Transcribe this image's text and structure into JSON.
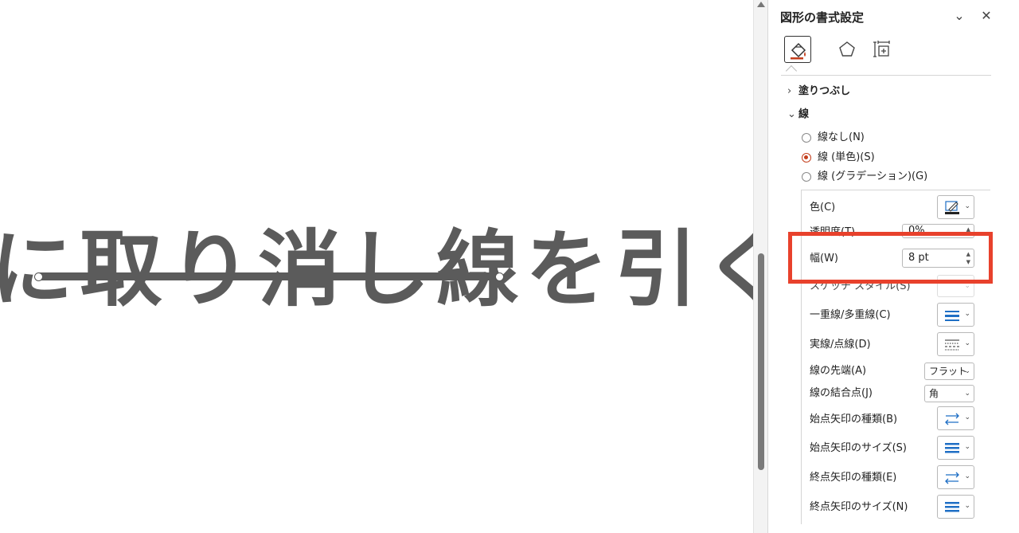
{
  "canvas": {
    "slide_text": "に取り消し線を引く"
  },
  "pane": {
    "title": "図形の書式設定",
    "collapse_glyph": "⌄",
    "close_glyph": "✕",
    "tabs": [
      "fill-and-line",
      "effects",
      "size-and-properties"
    ],
    "sections": {
      "fill": {
        "label": "塗りつぶし",
        "expanded": false
      },
      "line": {
        "label": "線",
        "expanded": true
      }
    },
    "line_options": [
      {
        "label": "線なし(N)",
        "selected": false
      },
      {
        "label": "線 (単色)(S)",
        "selected": true
      },
      {
        "label": "線 (グラデーション)(G)",
        "selected": false
      }
    ],
    "props": {
      "color": {
        "label": "色(C)"
      },
      "transparency": {
        "label": "透明度(T)",
        "value": "0%"
      },
      "width": {
        "label": "幅(W)",
        "value": "8 pt"
      },
      "sketch": {
        "label": "スケッチ スタイル(S)"
      },
      "compound": {
        "label": "一重線/多重線(C)"
      },
      "dash": {
        "label": "実線/点線(D)"
      },
      "cap": {
        "label": "線の先端(A)",
        "value": "フラット"
      },
      "join": {
        "label": "線の結合点(J)",
        "value": "角"
      },
      "begin_arrow_type": {
        "label": "始点矢印の種類(B)"
      },
      "begin_arrow_size": {
        "label": "始点矢印のサイズ(S)"
      },
      "end_arrow_type": {
        "label": "終点矢印の種類(E)"
      },
      "end_arrow_size": {
        "label": "終点矢印のサイズ(N)"
      }
    }
  },
  "colors": {
    "accent": "#c43e1c",
    "highlight_box": "#e8412c",
    "slide_text": "#5b5b5b",
    "icon_blue": "#1f6fc5"
  }
}
